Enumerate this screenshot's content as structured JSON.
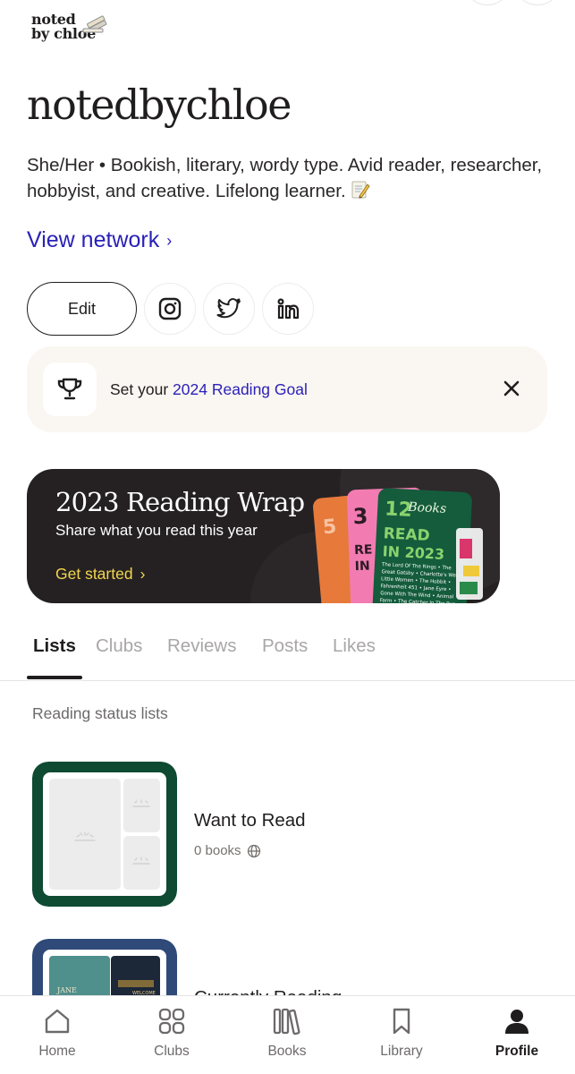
{
  "logo": {
    "line1": "noted",
    "line2": "by chloe"
  },
  "profile": {
    "name": "notedbychloe",
    "bio": "She/Her • Bookish, literary, wordy type. Avid reader, researcher, hobbyist, and creative. Lifelong learner.",
    "view_network": "View network"
  },
  "actions": {
    "edit_label": "Edit",
    "socials": [
      "instagram-icon",
      "twitter-icon",
      "linkedin-icon"
    ]
  },
  "goal": {
    "prefix": "Set your ",
    "link": "2024 Reading Goal"
  },
  "wrap": {
    "title": "2023 Reading Wrap",
    "subtitle": "Share what you read this year",
    "cta": "Get started",
    "card_text": [
      "12",
      "Books",
      "READ",
      "IN 2023",
      "The Lord Of The Rings • The Great Gatsby • Charlotte's Web • Little Women • The Hobbit • Fahrenheit 451 • Jane Eyre • Gone With The Wind • Animal Farm • The Catcher In The Rye"
    ],
    "card_colors": [
      "#e7793b",
      "#f27cb2",
      "#145c3c"
    ]
  },
  "tabs": [
    {
      "label": "Lists",
      "active": true
    },
    {
      "label": "Clubs",
      "active": false
    },
    {
      "label": "Reviews",
      "active": false
    },
    {
      "label": "Posts",
      "active": false
    },
    {
      "label": "Likes",
      "active": false
    }
  ],
  "section_label": "Reading status lists",
  "lists": [
    {
      "name": "Want to Read",
      "count": "0 books",
      "frame_color": "#0f4a32"
    },
    {
      "name": "Currently Reading",
      "count": "",
      "frame_color": "#2f4a78",
      "cover_text": "JANE",
      "cover_text2": "WELCOME"
    }
  ],
  "nav": [
    {
      "label": "Home",
      "icon": "home-icon",
      "active": false
    },
    {
      "label": "Clubs",
      "icon": "clubs-icon",
      "active": false
    },
    {
      "label": "Books",
      "icon": "books-icon",
      "active": false
    },
    {
      "label": "Library",
      "icon": "bookmark-icon",
      "active": false
    },
    {
      "label": "Profile",
      "icon": "profile-icon",
      "active": true
    }
  ],
  "colors": {
    "accent": "#2a21b8",
    "cta_yellow": "#f2d64b",
    "goal_bg": "#faf6f1",
    "banner_bg": "#252123"
  }
}
